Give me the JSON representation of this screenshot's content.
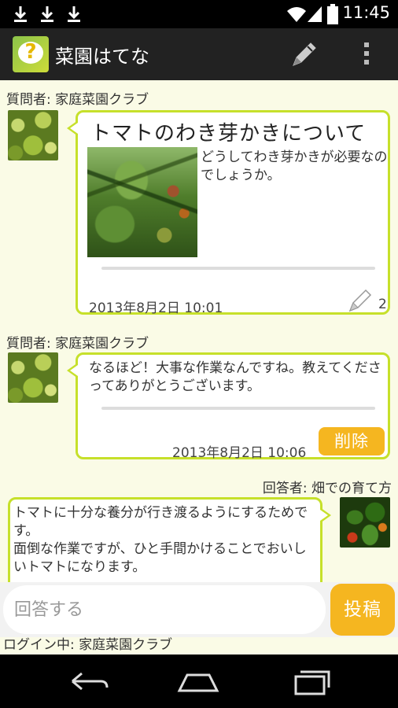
{
  "status_bar": {
    "time": "11:45",
    "icons": [
      "download-icon",
      "download-icon",
      "download-icon",
      "wifi-icon",
      "signal-icon",
      "battery-icon"
    ]
  },
  "app_bar": {
    "title": "菜園はてな",
    "logo_glyph": "?",
    "actions": [
      "pencil-icon",
      "overflow-menu-icon"
    ]
  },
  "thread": {
    "question": {
      "author_label": "質問者: 家庭菜園クラブ",
      "title": "トマトのわき芽かきについて",
      "body": "どうしてわき芽かきが必要なのでしょうか。",
      "timestamp": "2013年8月2日 10:01",
      "edit_count": "2"
    },
    "reply": {
      "author_label": "質問者: 家庭菜園クラブ",
      "body": "なるほど！大事な作業なんですね。教えてくださってありがとうございます。",
      "timestamp": "2013年8月2日 10:06",
      "delete_label": "削除"
    },
    "answer": {
      "author_label": "回答者: 畑での育て方",
      "body_line1": "トマトに十分な養分が行き渡るようにするためです。",
      "body_line2": "面倒な作業ですが、ひと手間かけることでおいしいトマトになります。"
    }
  },
  "composer": {
    "placeholder": "回答する",
    "value": "",
    "post_label": "投稿"
  },
  "login_status": "ログイン中: 家庭菜園クラブ",
  "nav_bar": [
    "back-icon",
    "home-icon",
    "recent-apps-icon"
  ],
  "colors": {
    "accent_border": "#c6e02a",
    "button_orange": "#f5b620",
    "content_bg": "#fafbe6",
    "app_bar_bg": "#222222"
  }
}
